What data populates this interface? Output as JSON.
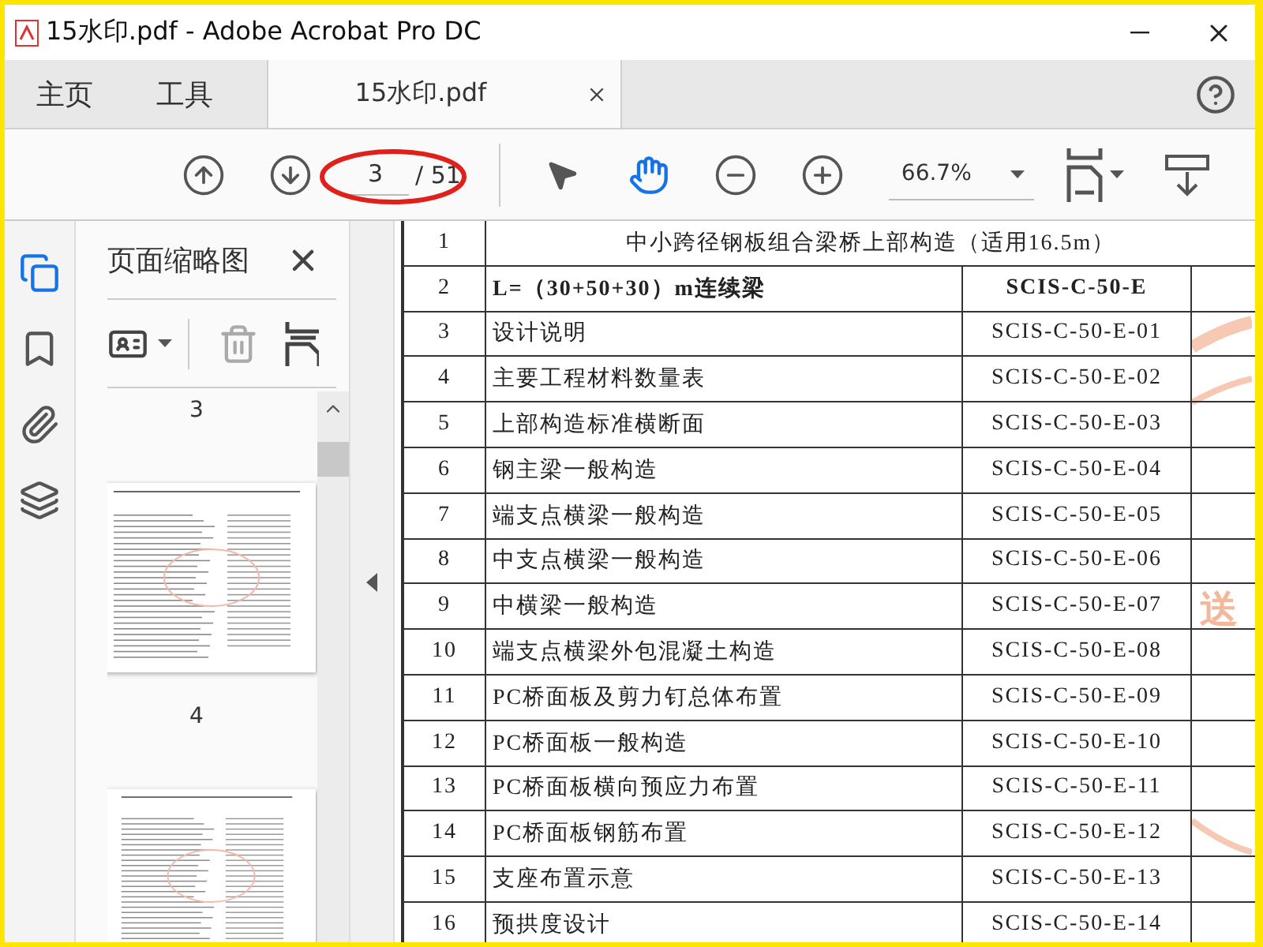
{
  "window": {
    "title": "15水印.pdf - Adobe Acrobat Pro DC"
  },
  "nav_tabs": [
    {
      "label": "主页",
      "selected": false
    },
    {
      "label": "工具",
      "selected": false
    },
    {
      "label": "15水印.pdf",
      "selected": true
    }
  ],
  "toolbar": {
    "page_number": "3",
    "page_total": "/ 51",
    "zoom": "66.7%",
    "tools": [
      {
        "kind": "select",
        "selected": false
      },
      {
        "kind": "hand",
        "selected": true
      }
    ]
  },
  "side_rail": [
    {
      "kind": "pages",
      "selected": true
    },
    {
      "kind": "bookmarks",
      "selected": false
    },
    {
      "kind": "attachments",
      "selected": false
    },
    {
      "kind": "layers",
      "selected": false
    }
  ],
  "thumbnails_panel": {
    "title": "页面缩略图",
    "items": [
      {
        "kind": "label",
        "text": "3"
      },
      {
        "kind": "thumbnail"
      },
      {
        "kind": "label",
        "text": "4"
      },
      {
        "kind": "thumbnail"
      }
    ]
  },
  "document": {
    "stamp": "送",
    "rows": [
      {
        "kind": "heading",
        "no": "1",
        "title": "中小跨径钢板组合梁桥上部构造（适用16.5m）"
      },
      {
        "kind": "bold",
        "no": "2",
        "title": "L=（30+50+30）m连续梁",
        "code": "SCIS-C-50-E"
      },
      {
        "kind": "normal",
        "no": "3",
        "title": "设计说明",
        "code": "SCIS-C-50-E-01"
      },
      {
        "kind": "normal",
        "no": "4",
        "title": "主要工程材料数量表",
        "code": "SCIS-C-50-E-02"
      },
      {
        "kind": "normal",
        "no": "5",
        "title": "上部构造标准横断面",
        "code": "SCIS-C-50-E-03"
      },
      {
        "kind": "normal",
        "no": "6",
        "title": "钢主梁一般构造",
        "code": "SCIS-C-50-E-04"
      },
      {
        "kind": "normal",
        "no": "7",
        "title": "端支点横梁一般构造",
        "code": "SCIS-C-50-E-05"
      },
      {
        "kind": "normal",
        "no": "8",
        "title": "中支点横梁一般构造",
        "code": "SCIS-C-50-E-06"
      },
      {
        "kind": "normal",
        "no": "9",
        "title": "中横梁一般构造",
        "code": "SCIS-C-50-E-07"
      },
      {
        "kind": "normal",
        "no": "10",
        "title": "端支点横梁外包混凝土构造",
        "code": "SCIS-C-50-E-08"
      },
      {
        "kind": "normal",
        "no": "11",
        "title": "PC桥面板及剪力钉总体布置",
        "code": "SCIS-C-50-E-09"
      },
      {
        "kind": "normal",
        "no": "12",
        "title": "PC桥面板一般构造",
        "code": "SCIS-C-50-E-10"
      },
      {
        "kind": "normal",
        "no": "13",
        "title": "PC桥面板横向预应力布置",
        "code": "SCIS-C-50-E-11"
      },
      {
        "kind": "normal",
        "no": "14",
        "title": "PC桥面板钢筋布置",
        "code": "SCIS-C-50-E-12"
      },
      {
        "kind": "normal",
        "no": "15",
        "title": "支座布置示意",
        "code": "SCIS-C-50-E-13"
      },
      {
        "kind": "normal",
        "no": "16",
        "title": "预拱度设计",
        "code": "SCIS-C-50-E-14"
      }
    ]
  }
}
